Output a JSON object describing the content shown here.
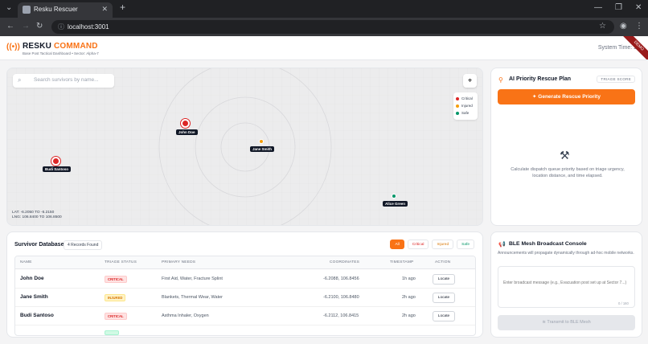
{
  "browser": {
    "tab_title": "Resku Rescuer",
    "url": "localhost:3001"
  },
  "header": {
    "brand_part1": "RESKU",
    "brand_part2": "COMMAND",
    "subtitle": "Base Post Tactical Dashboard • Sector: Alpha-7",
    "system_time": "System Time: 22",
    "ribbon": "DEMO"
  },
  "map": {
    "search_placeholder": "Search survivors by name...",
    "legend": [
      {
        "label": "Critical",
        "color": "#dc2626"
      },
      {
        "label": "Injured",
        "color": "#f59e0b"
      },
      {
        "label": "Safe",
        "color": "#059669"
      }
    ],
    "lat_range": "LAT: -6.2050 TO -6.2150",
    "lng_range": "LNG: 106.8400 TO 106.8500",
    "markers": [
      {
        "name": "John Doe",
        "status": "critical"
      },
      {
        "name": "Jane Smith",
        "status": "injured"
      },
      {
        "name": "Budi Santoso",
        "status": "critical"
      },
      {
        "name": "Alice Green",
        "status": "safe"
      }
    ]
  },
  "priority": {
    "title": "AI Priority Rescue Plan",
    "chip": "TRIAGE SCORE",
    "generate_label": "Generate Rescue Priority",
    "description": "Calculate dispatch queue priority based on triage urgency, location distance, and time elapsed."
  },
  "database": {
    "title": "Survivor Database",
    "count": "4 Records Found",
    "filters": [
      "All",
      "Critical",
      "Injured",
      "Safe"
    ],
    "columns": [
      "NAME",
      "TRIAGE STATUS",
      "PRIMARY NEEDS",
      "COORDINATES",
      "TIMESTAMP",
      "ACTION"
    ],
    "rows": [
      {
        "name": "John Doe",
        "status": "CRITICAL",
        "status_key": "critical",
        "needs": "First Aid, Water, Fracture Splint",
        "coords": "-6.2088, 106.8456",
        "time": "1h ago",
        "action": "Locate"
      },
      {
        "name": "Jane Smith",
        "status": "INJURED",
        "status_key": "injured",
        "needs": "Blankets, Thermal Wear, Water",
        "coords": "-6.2100, 106.8480",
        "time": "2h ago",
        "action": "Locate"
      },
      {
        "name": "Budi Santoso",
        "status": "CRITICAL",
        "status_key": "critical",
        "needs": "Asthma Inhaler, Oxygen",
        "coords": "-6.2112, 106.8415",
        "time": "2h ago",
        "action": "Locate"
      }
    ]
  },
  "ble": {
    "title": "BLE Mesh Broadcast Console",
    "description": "Announcements will propagate dynamically through ad-hoc mobile networks.",
    "placeholder": "Enter broadcast message (e.g., Evacuation post set up at Sector 7...)",
    "char_count": "0 / 160",
    "transmit_label": "Transmit to BLE Mesh"
  }
}
